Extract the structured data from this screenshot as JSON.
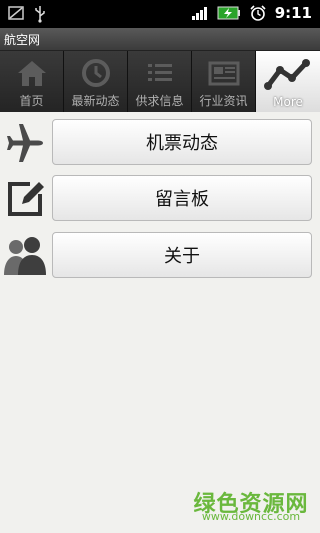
{
  "status_bar": {
    "time": "9:11"
  },
  "app": {
    "title": "航空网"
  },
  "tabs": [
    {
      "label": "首页"
    },
    {
      "label": "最新动态"
    },
    {
      "label": "供求信息"
    },
    {
      "label": "行业资讯"
    },
    {
      "label": "More"
    }
  ],
  "menu": {
    "items": [
      {
        "label": "机票动态",
        "icon": "airplane-icon"
      },
      {
        "label": "留言板",
        "icon": "edit-icon"
      },
      {
        "label": "关于",
        "icon": "people-icon"
      }
    ]
  },
  "watermark": {
    "text": "绿色资源网",
    "url": "www.downcc.com"
  }
}
